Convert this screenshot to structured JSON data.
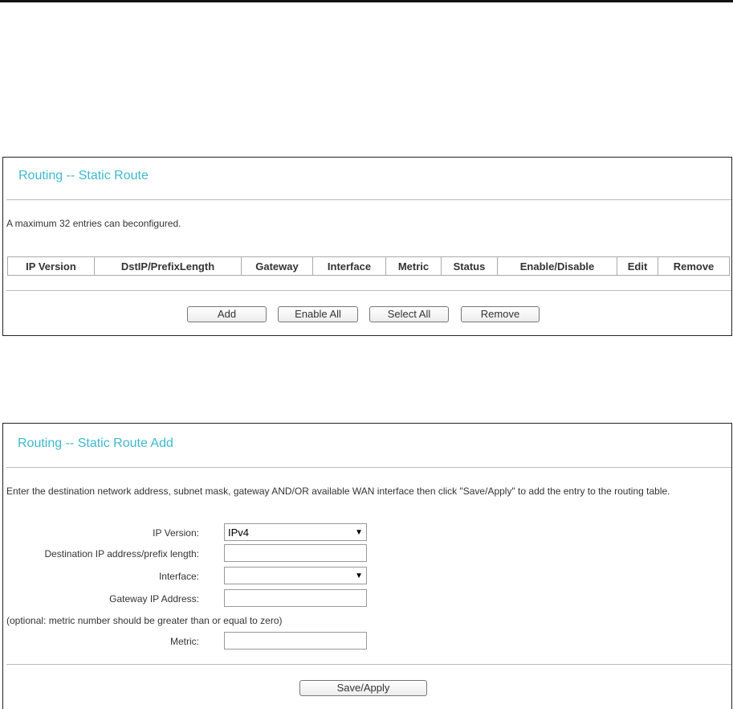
{
  "panel1": {
    "title": "Routing -- Static Route",
    "note": "A maximum 32 entries can beconfigured.",
    "columns": [
      "IP Version",
      "DstIP/PrefixLength",
      "Gateway",
      "Interface",
      "Metric",
      "Status",
      "Enable/Disable",
      "Edit",
      "Remove"
    ],
    "buttons": {
      "add": "Add",
      "enable_all": "Enable All",
      "select_all": "Select All",
      "remove": "Remove"
    }
  },
  "panel2": {
    "title": "Routing -- Static Route Add",
    "instructions": "Enter the destination network address, subnet mask, gateway AND/OR available WAN interface then click \"Save/Apply\" to add the entry to the routing table.",
    "fields": {
      "ip_version_label": "IP Version:",
      "ip_version_value": "IPv4",
      "destination_label": "Destination IP address/prefix length:",
      "destination_value": "",
      "interface_label": "Interface:",
      "interface_value": "",
      "gateway_label": "Gateway IP Address:",
      "gateway_value": "",
      "metric_note": "(optional: metric number should be greater than or equal to zero)",
      "metric_label": "Metric:",
      "metric_value": ""
    },
    "save_button": "Save/Apply"
  }
}
